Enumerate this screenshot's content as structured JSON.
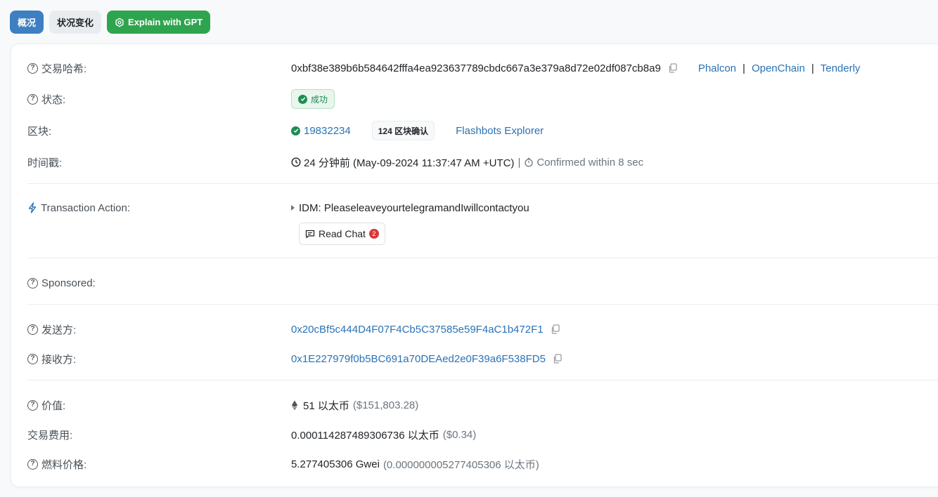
{
  "tabs": {
    "overview": "概况",
    "state": "状况变化",
    "gpt": "Explain with GPT"
  },
  "colors": {
    "accent": "#3d7fc1",
    "success": "#2fa44f",
    "link": "#2a72b5"
  },
  "rows": {
    "hash": {
      "label": "交易哈希:",
      "value": "0xbf38e389b6b584642fffa4ea923637789cbdc667a3e379a8d72e02df087cb8a9",
      "links": [
        "Phalcon",
        "OpenChain",
        "Tenderly"
      ],
      "sep": "|"
    },
    "status": {
      "label": "状态:",
      "value": "成功"
    },
    "block": {
      "label": "区块:",
      "number": "19832234",
      "confirmations": "124 区块确认",
      "explorer": "Flashbots Explorer"
    },
    "timestamp": {
      "label": "时间戳:",
      "value": "24 分钟前 (May-09-2024 11:37:47 AM +UTC)",
      "sep": "|",
      "confirmed": "Confirmed within 8 sec"
    },
    "action": {
      "label": "Transaction Action:",
      "value": "IDM: PleaseleaveyourtelegramandIwillcontactyou",
      "button": "Read Chat",
      "count": "2"
    },
    "sponsored": {
      "label": "Sponsored:"
    },
    "from": {
      "label": "发送方:",
      "value": "0x20cBf5c444D4F07F4Cb5C37585e59F4aC1b472F1"
    },
    "to": {
      "label": "接收方:",
      "value": "0x1E227979f0b5BC691a70DEAed2e0F39a6F538FD5"
    },
    "value": {
      "label": "价值:",
      "amount": "51 以太币",
      "usd": "($151,803.28)"
    },
    "fee": {
      "label": "交易费用:",
      "amount": "0.000114287489306736 以太币",
      "usd": "($0.34)"
    },
    "gas": {
      "label": "燃料价格:",
      "amount": "5.277405306 Gwei",
      "eth": "(0.000000005277405306 以太币)"
    }
  }
}
